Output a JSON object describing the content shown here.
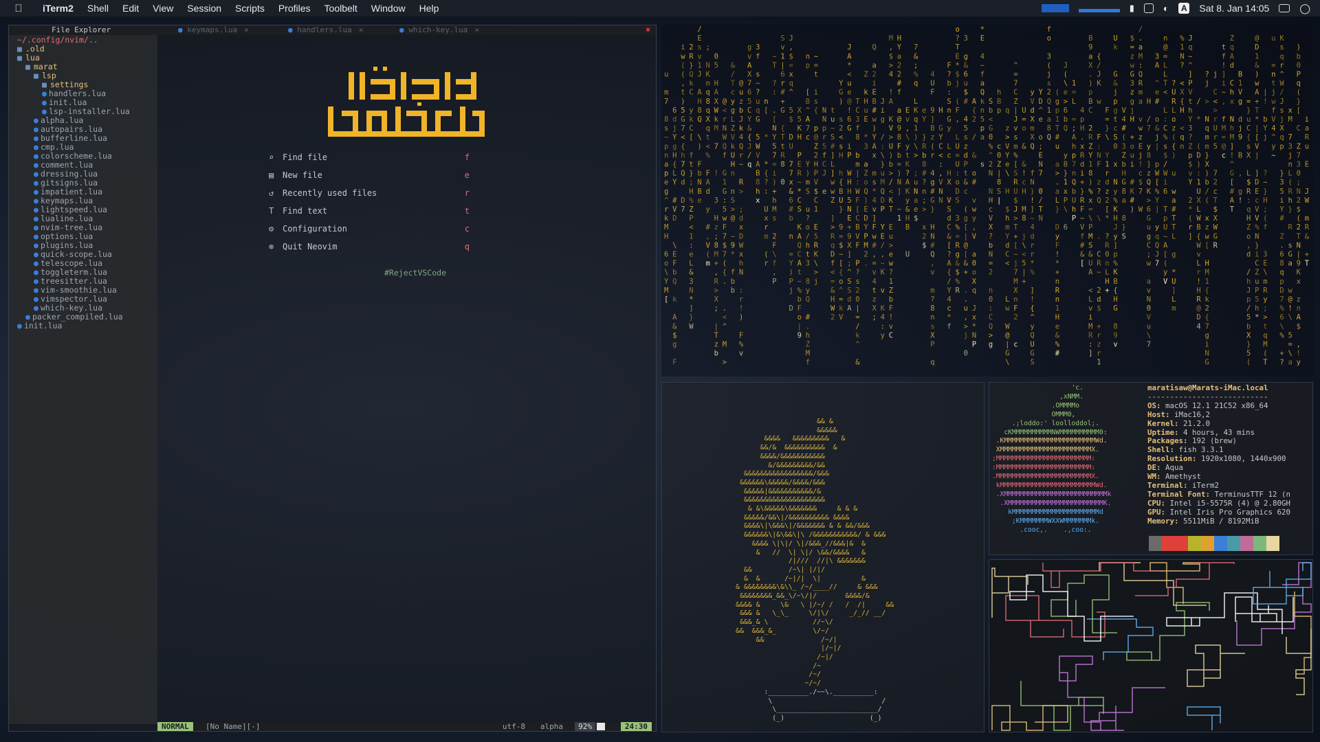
{
  "menubar": {
    "app": "iTerm2",
    "items": [
      "Shell",
      "Edit",
      "View",
      "Session",
      "Scripts",
      "Profiles",
      "Toolbelt",
      "Window",
      "Help"
    ],
    "clock": "Sat 8. Jan  14:05"
  },
  "nvim": {
    "tree_title": "File Explorer",
    "tabs": [
      {
        "label": "keymaps.lua"
      },
      {
        "label": "handlers.lua"
      },
      {
        "label": "which-key.lua"
      }
    ],
    "cwd": "~/.config/nvim/..",
    "tree": [
      {
        "label": ".old",
        "kind": "dir",
        "depth": 0
      },
      {
        "label": "lua",
        "kind": "dir",
        "depth": 0
      },
      {
        "label": "marat",
        "kind": "dir",
        "depth": 1
      },
      {
        "label": "lsp",
        "kind": "dir",
        "depth": 2
      },
      {
        "label": "settings",
        "kind": "dir",
        "depth": 3
      },
      {
        "label": "handlers.lua",
        "kind": "file",
        "depth": 3
      },
      {
        "label": "init.lua",
        "kind": "file",
        "depth": 3
      },
      {
        "label": "lsp-installer.lua",
        "kind": "file",
        "depth": 3
      },
      {
        "label": "alpha.lua",
        "kind": "file",
        "depth": 2
      },
      {
        "label": "autopairs.lua",
        "kind": "file",
        "depth": 2
      },
      {
        "label": "bufferline.lua",
        "kind": "file",
        "depth": 2
      },
      {
        "label": "cmp.lua",
        "kind": "file",
        "depth": 2
      },
      {
        "label": "colorscheme.lua",
        "kind": "file",
        "depth": 2
      },
      {
        "label": "comment.lua",
        "kind": "file",
        "depth": 2
      },
      {
        "label": "dressing.lua",
        "kind": "file",
        "depth": 2
      },
      {
        "label": "gitsigns.lua",
        "kind": "file",
        "depth": 2
      },
      {
        "label": "impatient.lua",
        "kind": "file",
        "depth": 2
      },
      {
        "label": "keymaps.lua",
        "kind": "file",
        "depth": 2
      },
      {
        "label": "lightspeed.lua",
        "kind": "file",
        "depth": 2
      },
      {
        "label": "lualine.lua",
        "kind": "file",
        "depth": 2
      },
      {
        "label": "nvim-tree.lua",
        "kind": "file",
        "depth": 2
      },
      {
        "label": "options.lua",
        "kind": "file",
        "depth": 2
      },
      {
        "label": "plugins.lua",
        "kind": "file",
        "depth": 2
      },
      {
        "label": "quick-scope.lua",
        "kind": "file",
        "depth": 2
      },
      {
        "label": "telescope.lua",
        "kind": "file",
        "depth": 2
      },
      {
        "label": "toggleterm.lua",
        "kind": "file",
        "depth": 2
      },
      {
        "label": "treesitter.lua",
        "kind": "file",
        "depth": 2
      },
      {
        "label": "vim-smoothie.lua",
        "kind": "file",
        "depth": 2
      },
      {
        "label": "vimspector.lua",
        "kind": "file",
        "depth": 2
      },
      {
        "label": "which-key.lua",
        "kind": "file",
        "depth": 2
      },
      {
        "label": "packer_compiled.lua",
        "kind": "file",
        "depth": 1
      },
      {
        "label": "init.lua",
        "kind": "file",
        "depth": 0
      }
    ],
    "dashboard": {
      "logo_text": "العلم قبل القول والعمل",
      "buttons": [
        {
          "icon": "file-search-icon",
          "glyph": "⌕",
          "label": "Find file",
          "key": "f"
        },
        {
          "icon": "new-file-icon",
          "glyph": "▤",
          "label": "New file",
          "key": "e"
        },
        {
          "icon": "history-icon",
          "glyph": "↺",
          "label": "Recently used files",
          "key": "r"
        },
        {
          "icon": "text-icon",
          "glyph": "T",
          "label": "Find text",
          "key": "t"
        },
        {
          "icon": "gear-icon",
          "glyph": "⚙",
          "label": "Configuration",
          "key": "c"
        },
        {
          "icon": "quit-icon",
          "glyph": "⊗",
          "label": "Quit Neovim",
          "key": "q"
        }
      ],
      "footer": "#RejectVSCode"
    },
    "statusline": {
      "mode": "NORMAL",
      "file": "[No Name][-]",
      "encoding": "utf-8",
      "filetype": "alpha",
      "percent": "92%",
      "position": "24:30"
    }
  },
  "neofetch": {
    "header": "maratisaw@Marats-iMac.local",
    "separator": "---------------------------",
    "fields": [
      {
        "label": "OS",
        "value": "macOS 12.1 21C52 x86_64"
      },
      {
        "label": "Host",
        "value": "iMac16,2"
      },
      {
        "label": "Kernel",
        "value": "21.2.0"
      },
      {
        "label": "Uptime",
        "value": "4 hours, 43 mins"
      },
      {
        "label": "Packages",
        "value": "192 (brew)"
      },
      {
        "label": "Shell",
        "value": "fish 3.3.1"
      },
      {
        "label": "Resolution",
        "value": "1920x1080, 1440x900"
      },
      {
        "label": "DE",
        "value": "Aqua"
      },
      {
        "label": "WM",
        "value": "Amethyst"
      },
      {
        "label": "Terminal",
        "value": "iTerm2"
      },
      {
        "label": "Terminal Font",
        "value": "TerminusTTF 12 (n"
      },
      {
        "label": "CPU",
        "value": "Intel i5-5575R (4) @ 2.80GH"
      },
      {
        "label": "GPU",
        "value": "Intel Iris Pro Graphics 620"
      },
      {
        "label": "Memory",
        "value": "5511MiB / 8192MiB"
      }
    ],
    "palette": [
      "#6b6b6b",
      "#e0403a",
      "#e0403a",
      "#b6b42a",
      "#e0a030",
      "#3b7fd6",
      "#4a9aa8",
      "#c06c9a",
      "#7cb87c",
      "#e8d6a0"
    ]
  },
  "colors": {
    "accent_yellow": "#e5c07b",
    "accent_red": "#e06c75",
    "accent_green": "#98c379",
    "accent_blue": "#3b7fd6"
  }
}
